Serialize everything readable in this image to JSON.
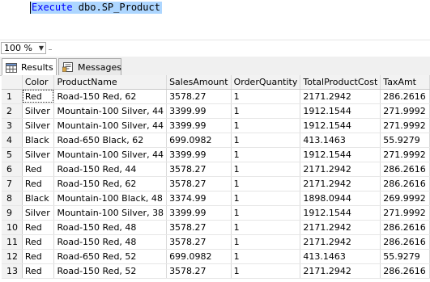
{
  "editor": {
    "query_keyword": "Execute",
    "query_object": " dbo.SP_Product"
  },
  "zoom": {
    "value": "100 %"
  },
  "tabs": [
    {
      "label": "Results",
      "active": true
    },
    {
      "label": "Messages",
      "active": false
    }
  ],
  "grid": {
    "columns": [
      "",
      "Color",
      "ProductName",
      "SalesAmount",
      "OrderQuantity",
      "TotalProductCost",
      "TaxAmt"
    ],
    "rows": [
      [
        "1",
        "Red",
        "Road-150 Red, 62",
        "3578.27",
        "1",
        "2171.2942",
        "286.2616"
      ],
      [
        "2",
        "Silver",
        "Mountain-100 Silver, 44",
        "3399.99",
        "1",
        "1912.1544",
        "271.9992"
      ],
      [
        "3",
        "Silver",
        "Mountain-100 Silver, 44",
        "3399.99",
        "1",
        "1912.1544",
        "271.9992"
      ],
      [
        "4",
        "Black",
        "Road-650 Black, 62",
        "699.0982",
        "1",
        "413.1463",
        "55.9279"
      ],
      [
        "5",
        "Silver",
        "Mountain-100 Silver, 44",
        "3399.99",
        "1",
        "1912.1544",
        "271.9992"
      ],
      [
        "6",
        "Red",
        "Road-150 Red, 44",
        "3578.27",
        "1",
        "2171.2942",
        "286.2616"
      ],
      [
        "7",
        "Red",
        "Road-150 Red, 62",
        "3578.27",
        "1",
        "2171.2942",
        "286.2616"
      ],
      [
        "8",
        "Black",
        "Mountain-100 Black, 48",
        "3374.99",
        "1",
        "1898.0944",
        "269.9992"
      ],
      [
        "9",
        "Silver",
        "Mountain-100 Silver, 38",
        "3399.99",
        "1",
        "1912.1544",
        "271.9992"
      ],
      [
        "10",
        "Red",
        "Road-150 Red, 48",
        "3578.27",
        "1",
        "2171.2942",
        "286.2616"
      ],
      [
        "11",
        "Red",
        "Road-150 Red, 48",
        "3578.27",
        "1",
        "2171.2942",
        "286.2616"
      ],
      [
        "12",
        "Red",
        "Road-650 Red, 52",
        "699.0982",
        "1",
        "413.1463",
        "55.9279"
      ],
      [
        "13",
        "Red",
        "Road-150 Red, 52",
        "3578.27",
        "1",
        "2171.2942",
        "286.2616"
      ]
    ]
  }
}
